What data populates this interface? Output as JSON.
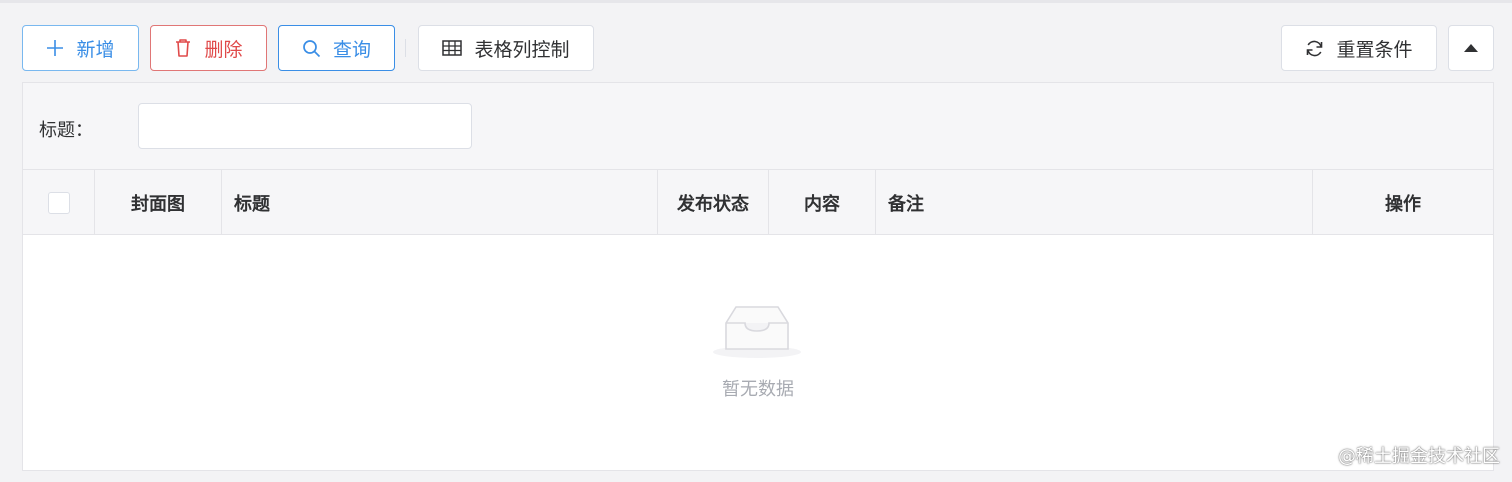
{
  "toolbar": {
    "add_label": "新增",
    "delete_label": "删除",
    "search_label": "查询",
    "columns_label": "表格列控制",
    "reset_label": "重置条件"
  },
  "search": {
    "title_label": "标题：",
    "title_value": "",
    "title_placeholder": ""
  },
  "table": {
    "columns": [
      "封面图",
      "标题",
      "发布状态",
      "内容",
      "备注",
      "操作"
    ],
    "rows": [],
    "empty_text": "暂无数据"
  },
  "watermark": {
    "text": "@稀土掘金技术社区"
  },
  "colors": {
    "primary": "#3a8ee6",
    "danger": "#e04a4a",
    "border": "#dcdfe6",
    "header_bg": "#f6f6f8"
  }
}
